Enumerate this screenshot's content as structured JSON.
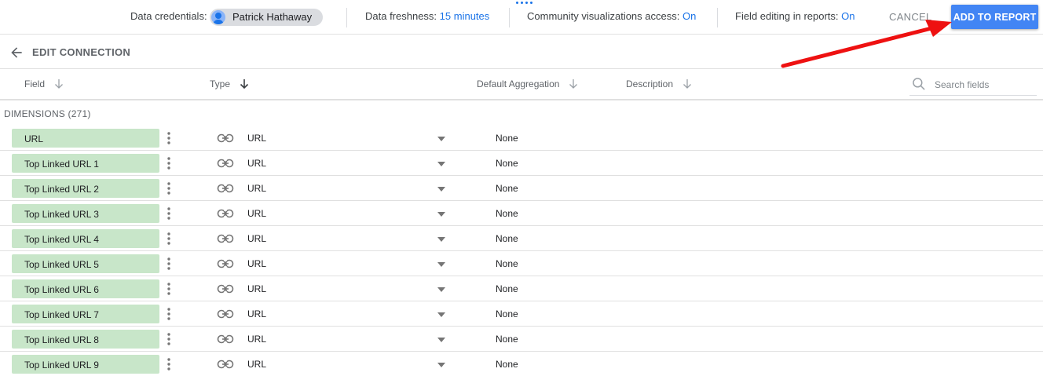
{
  "topbar": {
    "credentials_label": "Data credentials:",
    "credentials_user": "Patrick Hathaway",
    "freshness_label": "Data freshness:",
    "freshness_value": "15 minutes",
    "community_label": "Community visualizations access:",
    "community_value": "On",
    "field_editing_label": "Field editing in reports:",
    "field_editing_value": "On",
    "cancel_label": "CANCEL",
    "add_label": "ADD TO REPORT"
  },
  "edit": {
    "title": "EDIT CONNECTION"
  },
  "columns": {
    "field": "Field",
    "type": "Type",
    "aggregation": "Default Aggregation",
    "description": "Description"
  },
  "search": {
    "placeholder": "Search fields"
  },
  "section": {
    "title": "DIMENSIONS (271)"
  },
  "rows": [
    {
      "name": "URL",
      "type": "URL",
      "aggregation": "None"
    },
    {
      "name": "Top Linked URL 1",
      "type": "URL",
      "aggregation": "None"
    },
    {
      "name": "Top Linked URL 2",
      "type": "URL",
      "aggregation": "None"
    },
    {
      "name": "Top Linked URL 3",
      "type": "URL",
      "aggregation": "None"
    },
    {
      "name": "Top Linked URL 4",
      "type": "URL",
      "aggregation": "None"
    },
    {
      "name": "Top Linked URL 5",
      "type": "URL",
      "aggregation": "None"
    },
    {
      "name": "Top Linked URL 6",
      "type": "URL",
      "aggregation": "None"
    },
    {
      "name": "Top Linked URL 7",
      "type": "URL",
      "aggregation": "None"
    },
    {
      "name": "Top Linked URL 8",
      "type": "URL",
      "aggregation": "None"
    },
    {
      "name": "Top Linked URL 9",
      "type": "URL",
      "aggregation": "None"
    }
  ],
  "colors": {
    "accent": "#4285f4",
    "link": "#1a73e8",
    "dimension_chip": "#c8e6c9",
    "annotation_arrow": "#ee1111"
  },
  "icons": {
    "back": "arrow-left-icon",
    "sort": "arrow-down-icon",
    "search": "search-icon",
    "more": "more-vertical-icon",
    "type": "link-icon",
    "dropdown": "caret-down-icon",
    "avatar": "account-icon"
  }
}
